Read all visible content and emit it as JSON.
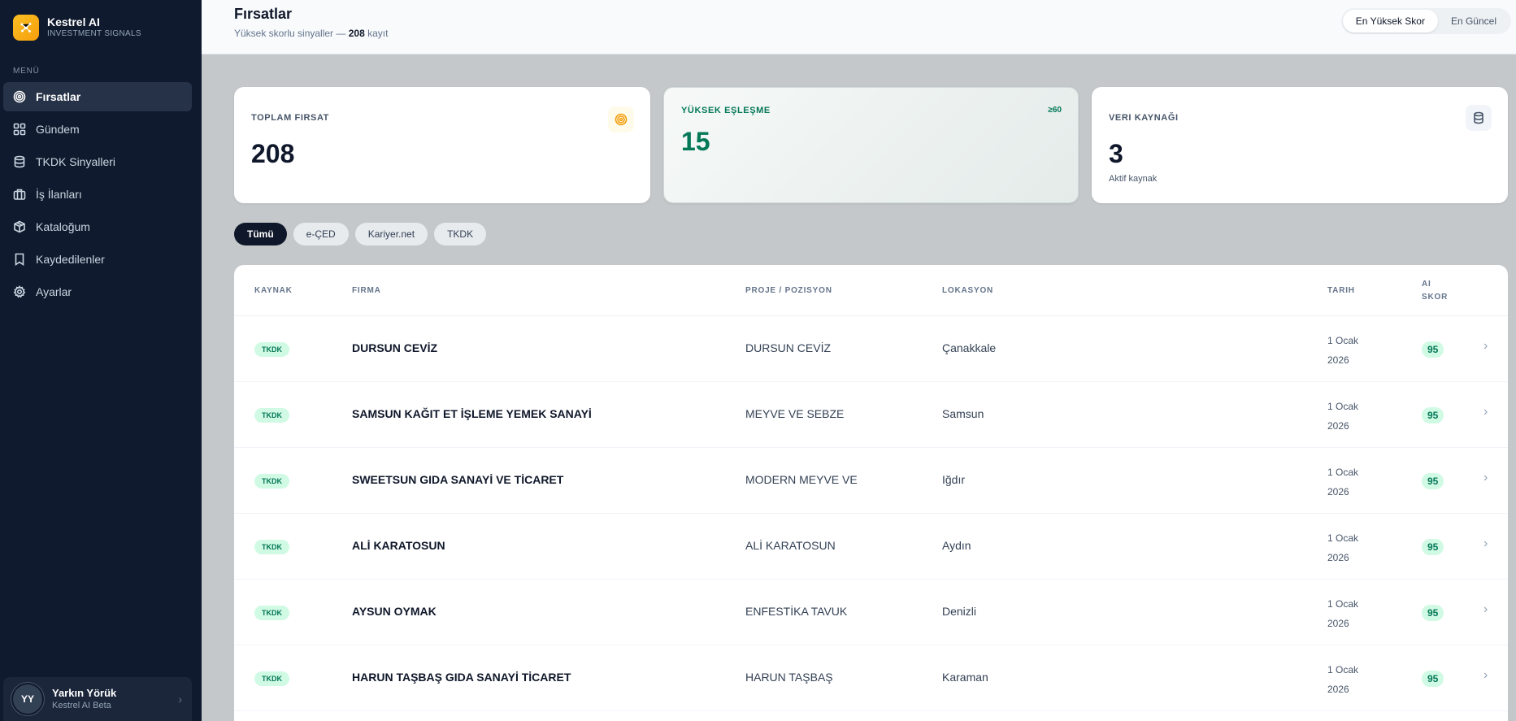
{
  "brand": {
    "name": "Kestrel AI",
    "subtitle": "INVESTMENT SIGNALS"
  },
  "sidebar": {
    "menu_title": "MENÜ",
    "items": [
      {
        "label": "Fırsatlar",
        "icon": "target-icon",
        "active": true
      },
      {
        "label": "Gündem",
        "icon": "dashboard-icon"
      },
      {
        "label": "TKDK Sinyalleri",
        "icon": "database-icon"
      },
      {
        "label": "İş İlanları",
        "icon": "briefcase-icon"
      },
      {
        "label": "Kataloğum",
        "icon": "package-icon"
      },
      {
        "label": "Kaydedilenler",
        "icon": "bookmark-icon"
      },
      {
        "label": "Ayarlar",
        "icon": "gear-icon"
      }
    ],
    "user": {
      "initials": "YY",
      "name": "Yarkın Yörük",
      "role": "Kestrel AI Beta"
    }
  },
  "header": {
    "title": "Fırsatlar",
    "subtitle_prefix": "Yüksek skorlu sinyaller — ",
    "subtitle_count": "208",
    "subtitle_suffix": " kayıt",
    "sort": {
      "active": "En Yüksek Skor",
      "other": "En Güncel"
    }
  },
  "stats": {
    "total": {
      "label": "TOPLAM FIRSAT",
      "value": "208"
    },
    "high": {
      "label": "YÜKSEK EŞLEŞME",
      "value": "15",
      "badge": "≥60"
    },
    "sources": {
      "label": "VERI KAYNAĞI",
      "value": "3",
      "note": "Aktif kaynak"
    }
  },
  "filters": [
    "Tümü",
    "e-ÇED",
    "Kariyer.net",
    "TKDK"
  ],
  "table": {
    "headers": {
      "source": "KAYNAK",
      "firm": "FIRMA",
      "project": "PROJE / POZISYON",
      "location": "LOKASYON",
      "date": "TARIH",
      "score_line1": "AI",
      "score_line2": "SKOR"
    },
    "rows": [
      {
        "source": "TKDK",
        "firm": "DURSUN CEVİZ",
        "project": "DURSUN CEVİZ",
        "location": "Çanakkale",
        "date_line1": "1 Ocak",
        "date_line2": "2026",
        "score": "95"
      },
      {
        "source": "TKDK",
        "firm": "SAMSUN KAĞIT ET İŞLEME YEMEK SANAYİ",
        "project": "MEYVE VE SEBZE",
        "location": "Samsun",
        "date_line1": "1 Ocak",
        "date_line2": "2026",
        "score": "95"
      },
      {
        "source": "TKDK",
        "firm": "SWEETSUN GIDA SANAYİ VE TİCARET",
        "project": "MODERN MEYVE VE",
        "location": "Iğdır",
        "date_line1": "1 Ocak",
        "date_line2": "2026",
        "score": "95"
      },
      {
        "source": "TKDK",
        "firm": "ALİ KARATOSUN",
        "project": "ALİ KARATOSUN",
        "location": "Aydın",
        "date_line1": "1 Ocak",
        "date_line2": "2026",
        "score": "95"
      },
      {
        "source": "TKDK",
        "firm": "AYSUN OYMAK",
        "project": "ENFESTİKA TAVUK",
        "location": "Denizli",
        "date_line1": "1 Ocak",
        "date_line2": "2026",
        "score": "95"
      },
      {
        "source": "TKDK",
        "firm": "HARUN TAŞBAŞ GIDA SANAYİ TİCARET",
        "project": "HARUN TAŞBAŞ",
        "location": "Karaman",
        "date_line1": "1 Ocak",
        "date_line2": "2026",
        "score": "95"
      }
    ]
  },
  "colors": {
    "sidebar_bg": "#0f1a2e",
    "accent_green": "#047857",
    "brand_amber": "#f59e0b"
  }
}
